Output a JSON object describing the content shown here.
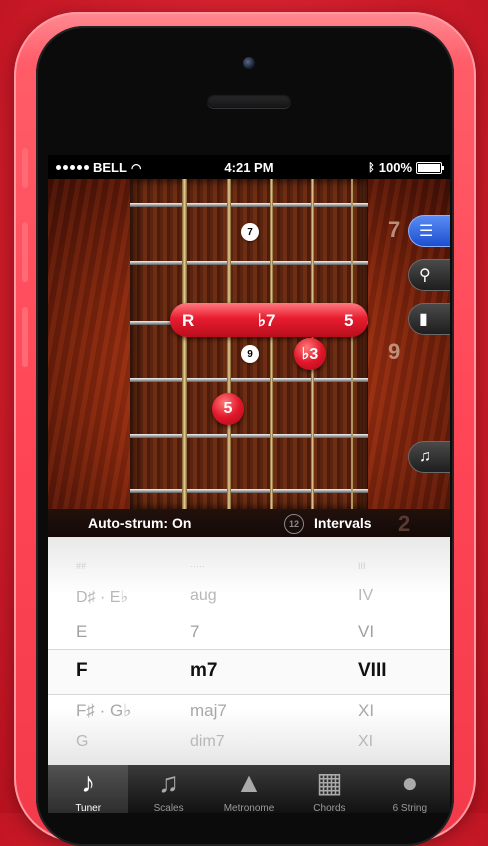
{
  "status_bar": {
    "carrier": "BELL",
    "time": "4:21 PM",
    "battery": "100%"
  },
  "fretboard": {
    "fret_numbers": [
      "7",
      "9"
    ],
    "inlay_markers": [
      "7",
      "9"
    ],
    "barre": {
      "left": "R",
      "middle": "♭7",
      "right": "5"
    },
    "notes": [
      "♭3",
      "5"
    ],
    "ghost_fret": "12",
    "ghost_right": "2"
  },
  "side_tools": [
    {
      "name": "list",
      "icon": "list-icon"
    },
    {
      "name": "search",
      "icon": "search-icon"
    },
    {
      "name": "document",
      "icon": "document-icon"
    },
    {
      "name": "music",
      "icon": "music-note-icon"
    }
  ],
  "fret_bar": {
    "autostrum": "Auto-strum: On",
    "intervals": "Intervals"
  },
  "picker": {
    "rows": [
      {
        "c1": "D♯ · E♭",
        "c2": "aug",
        "c3": "IV"
      },
      {
        "c1": "E",
        "c2": "7",
        "c3": "VI"
      },
      {
        "c1": "F",
        "c2": "m7",
        "c3": "VIII"
      },
      {
        "c1": "F♯ · G♭",
        "c2": "maj7",
        "c3": "XI"
      },
      {
        "c1": "G",
        "c2": "dim7",
        "c3": "XI"
      }
    ],
    "top_faint": {
      "c1": "##",
      "c2": "·····",
      "c3": "III"
    }
  },
  "tabbar": {
    "tabs": [
      {
        "label": "Tuner",
        "glyph": "♪",
        "icon": "guitar-head-icon"
      },
      {
        "label": "Scales",
        "glyph": "♫",
        "icon": "music-notes-icon"
      },
      {
        "label": "Metronome",
        "glyph": "▲",
        "icon": "metronome-icon"
      },
      {
        "label": "Chords",
        "glyph": "▦",
        "icon": "chord-grid-icon"
      },
      {
        "label": "6 String",
        "glyph": "●",
        "icon": "guitar-body-icon"
      }
    ]
  }
}
